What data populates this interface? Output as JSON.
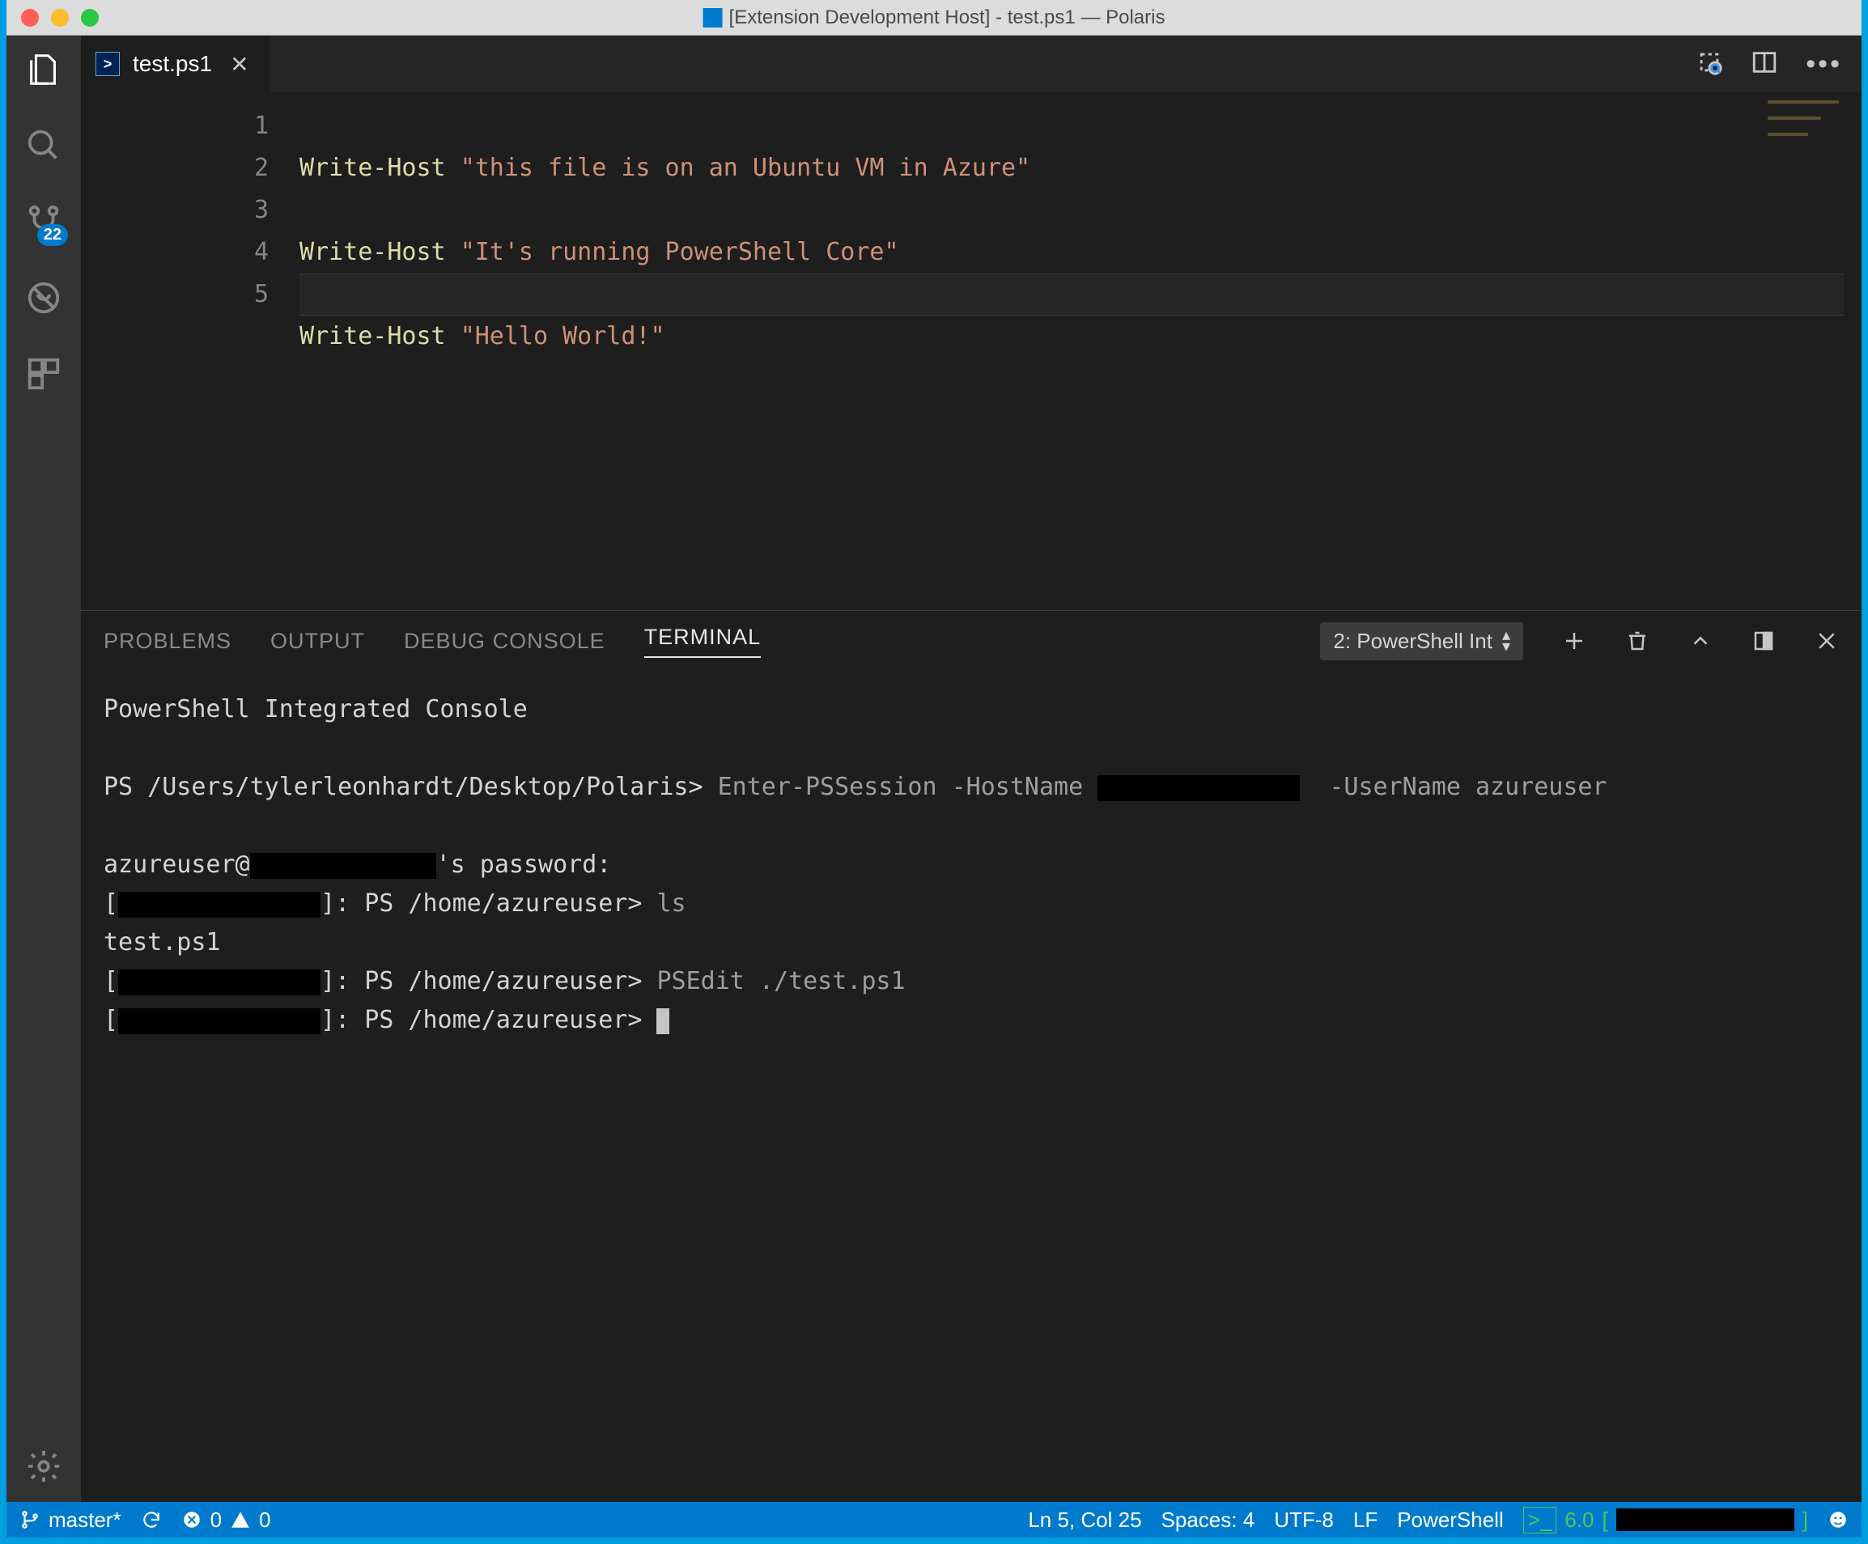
{
  "window": {
    "title": "[Extension Development Host] - test.ps1 — Polaris"
  },
  "activity": {
    "scm_badge": "22"
  },
  "tabs": {
    "file": "test.ps1"
  },
  "editor": {
    "lines": [
      {
        "n": "1",
        "cmd": "Write-Host",
        "str": "\"this file is on an Ubuntu VM in Azure\""
      },
      {
        "n": "2",
        "cmd": "",
        "str": ""
      },
      {
        "n": "3",
        "cmd": "Write-Host",
        "str": "\"It's running PowerShell Core\""
      },
      {
        "n": "4",
        "cmd": "",
        "str": ""
      },
      {
        "n": "5",
        "cmd": "Write-Host",
        "str": "\"Hello World!\""
      }
    ]
  },
  "panel": {
    "tabs": {
      "problems": "PROBLEMS",
      "output": "OUTPUT",
      "debug": "DEBUG CONSOLE",
      "terminal": "TERMINAL"
    },
    "terminal_selector": "2: PowerShell Int"
  },
  "terminal": {
    "banner": "PowerShell Integrated Console",
    "prompt1_prefix": "PS /Users/tylerleonhardt/Desktop/Polaris>",
    "prompt1_cmd": "Enter-PSSession -HostName",
    "prompt1_tail": "-UserName azureuser",
    "pw_prefix": "azureuser@",
    "pw_suffix": "'s password:",
    "remote_prompt": "]: PS /home/azureuser>",
    "cmd_ls": "ls",
    "ls_out": "test.ps1",
    "cmd_psedit": "PSEdit ./test.ps1"
  },
  "status": {
    "branch": "master*",
    "errors": "0",
    "warnings": "0",
    "lncol": "Ln 5, Col 25",
    "spaces": "Spaces: 4",
    "encoding": "UTF-8",
    "eol": "LF",
    "lang": "PowerShell",
    "psver": "6.0"
  }
}
